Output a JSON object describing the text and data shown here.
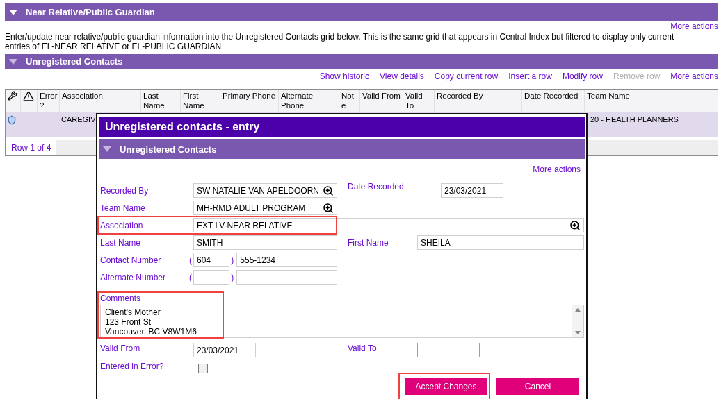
{
  "top_panel": {
    "title": "Near Relative/Public Guardian",
    "more_actions": "More actions",
    "description": "Enter/update near relative/public guardian information into the Unregistered Contacts grid below. This is the same grid that appears in Central Index but filtered to display only current entries of EL-NEAR RELATIVE or EL-PUBLIC GUARDIAN"
  },
  "contacts_panel": {
    "title": "Unregistered Contacts",
    "actions": [
      {
        "label": "Show historic",
        "disabled": false
      },
      {
        "label": "View details",
        "disabled": false
      },
      {
        "label": "Copy current row",
        "disabled": false
      },
      {
        "label": "Insert a row",
        "disabled": false
      },
      {
        "label": "Modify row",
        "disabled": false
      },
      {
        "label": "Remove row",
        "disabled": true
      },
      {
        "label": "More actions",
        "disabled": false
      }
    ],
    "table": {
      "columns": [
        {
          "kind": "tool"
        },
        {
          "kind": "warning"
        },
        {
          "kind": "text",
          "label": "Error ?"
        },
        {
          "kind": "text",
          "label": "Association"
        },
        {
          "kind": "text",
          "label": "Last Name"
        },
        {
          "kind": "text",
          "label": "First Name"
        },
        {
          "kind": "text",
          "label": "Primary Phone"
        },
        {
          "kind": "text",
          "label": "Alternate Phone"
        },
        {
          "kind": "text",
          "label": "Note"
        },
        {
          "kind": "text",
          "label": "Valid From"
        },
        {
          "kind": "text",
          "label": "Valid To"
        },
        {
          "kind": "text",
          "label": "Recorded By"
        },
        {
          "kind": "text",
          "label": "Date Recorded"
        },
        {
          "kind": "text",
          "label": "Team Name"
        }
      ],
      "rows": [
        {
          "selected": true,
          "association": "CAREGIV",
          "team_name": "20 - HEALTH PLANNERS"
        }
      ],
      "footer": "Row 1 of 4"
    }
  },
  "dialog": {
    "title": "Unregistered contacts - entry",
    "section": "Unregistered Contacts",
    "more_actions": "More actions",
    "recorded_by": {
      "label": "Recorded By",
      "value": "SW NATALIE VAN APELDOORN"
    },
    "date_recorded": {
      "label": "Date Recorded",
      "value": "23/03/2021"
    },
    "team_name": {
      "label": "Team Name",
      "value": "MH-RMD ADULT PROGRAM"
    },
    "association": {
      "label": "Association",
      "value": "EXT LV-NEAR RELATIVE",
      "highlighted": true
    },
    "last_name": {
      "label": "Last Name",
      "value": "SMITH"
    },
    "first_name": {
      "label": "First Name",
      "value": "SHEILA"
    },
    "contact_number": {
      "label": "Contact Number",
      "open": "(",
      "close": ")",
      "area": "604",
      "number": "555-1234"
    },
    "alternate_number": {
      "label": "Alternate Number",
      "open": "(",
      "close": ")"
    },
    "comments": {
      "label": "Comments",
      "value": "Client's Mother\n123 Front St\nVancouver, BC V8W1M6",
      "highlighted": true
    },
    "valid_from": {
      "label": "Valid From",
      "value": "23/03/2021"
    },
    "valid_to": {
      "label": "Valid To",
      "focused": true
    },
    "entered_in_error": {
      "label": "Entered in Error?",
      "checked": false
    },
    "buttons": [
      {
        "label": "Accept Changes",
        "highlighted": true
      },
      {
        "label": "Cancel",
        "highlighted": false
      }
    ]
  }
}
